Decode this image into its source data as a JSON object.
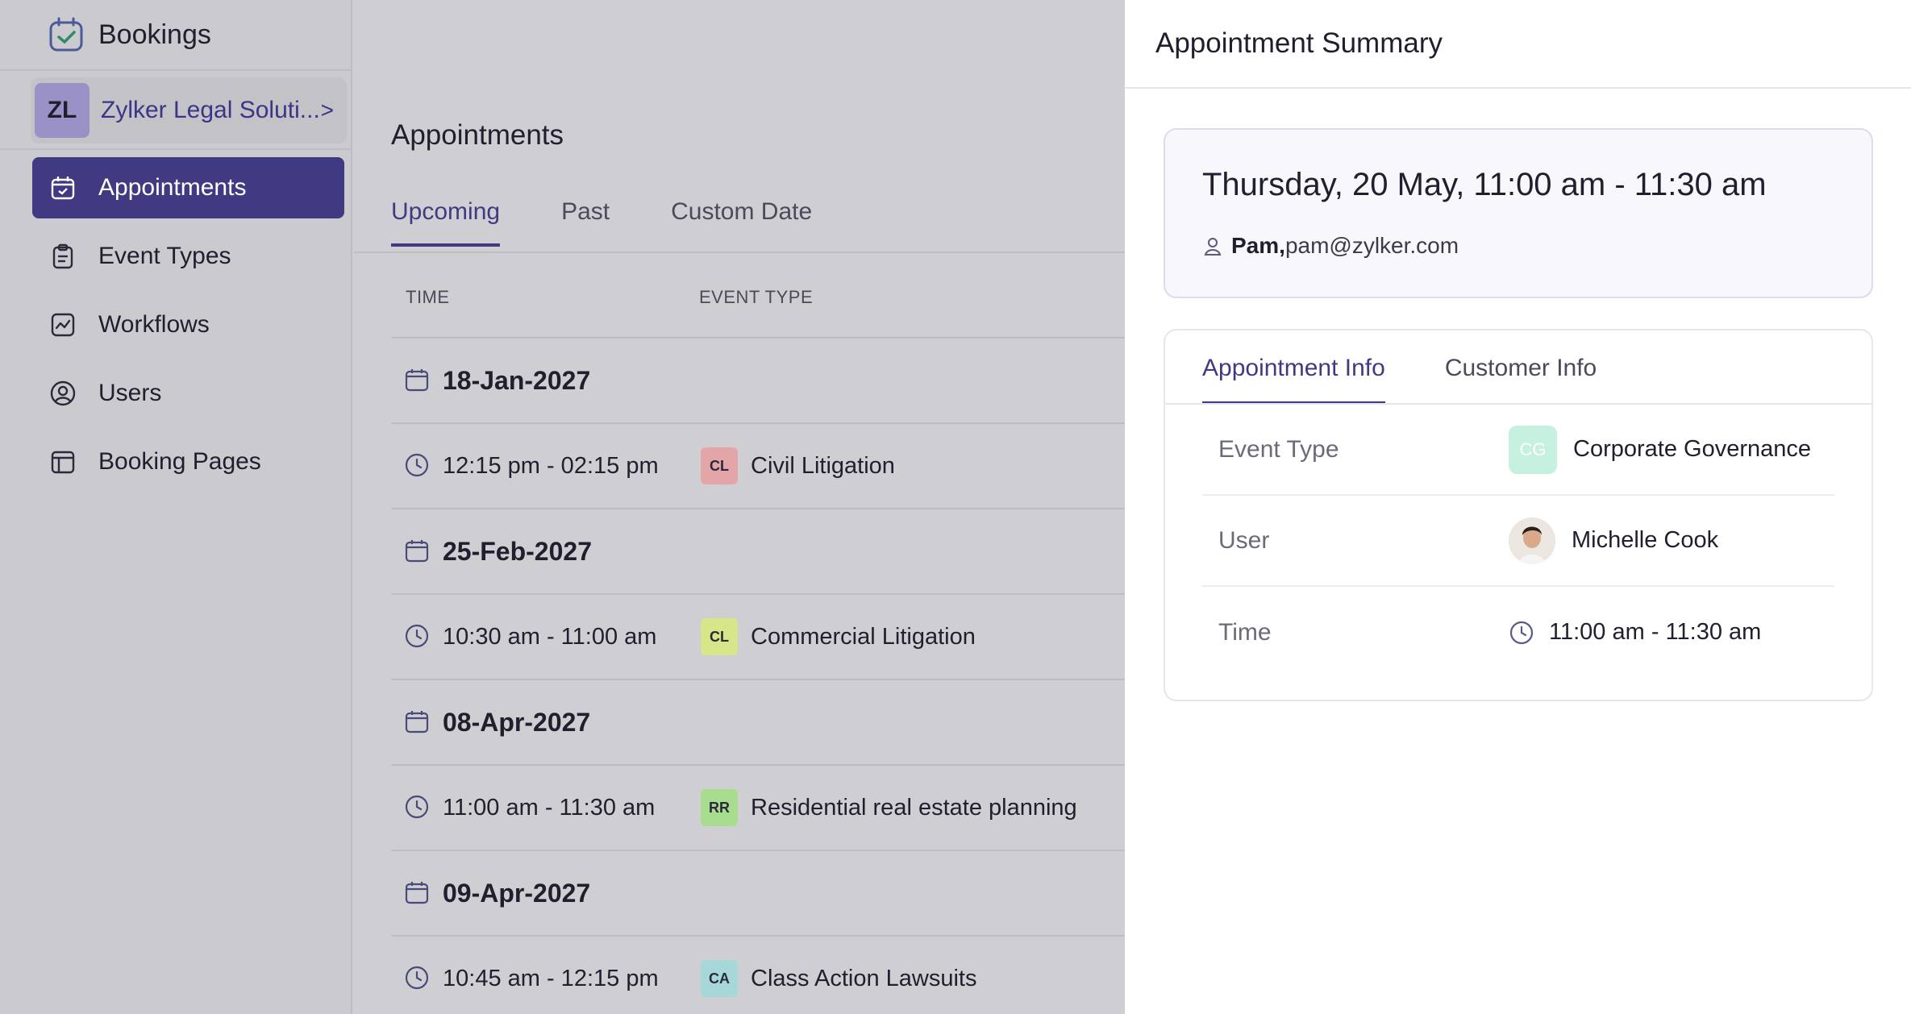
{
  "app": {
    "title": "Bookings"
  },
  "org": {
    "initials": "ZL",
    "name": "Zylker Legal Soluti...",
    "chevron": ">"
  },
  "nav": [
    {
      "label": "Appointments",
      "icon": "calendar-check-icon",
      "active": true
    },
    {
      "label": "Event Types",
      "icon": "clipboard-icon",
      "active": false
    },
    {
      "label": "Workflows",
      "icon": "workflow-icon",
      "active": false
    },
    {
      "label": "Users",
      "icon": "user-circle-icon",
      "active": false
    },
    {
      "label": "Booking Pages",
      "icon": "booking-page-icon",
      "active": false
    }
  ],
  "main": {
    "title": "Appointments",
    "tabs": [
      {
        "label": "Upcoming",
        "active": true
      },
      {
        "label": "Past",
        "active": false
      },
      {
        "label": "Custom Date",
        "active": false
      }
    ],
    "columns": {
      "time": "TIME",
      "event_type": "EVENT TYPE"
    },
    "groups": [
      {
        "date": "18-Jan-2027",
        "time": "12:15 pm - 02:15 pm",
        "badge": "CL",
        "badge_color": "#e4a5a8",
        "event": "Civil Litigation"
      },
      {
        "date": "25-Feb-2027",
        "time": "10:30 am - 11:00 am",
        "badge": "CL",
        "badge_color": "#d8e68a",
        "event": "Commercial Litigation"
      },
      {
        "date": "08-Apr-2027",
        "time": "11:00 am - 11:30 am",
        "badge": "RR",
        "badge_color": "#a8dc8e",
        "event": "Residential real estate planning"
      },
      {
        "date": "09-Apr-2027",
        "time": "10:45 am - 12:15 pm",
        "badge": "CA",
        "badge_color": "#a6d8da",
        "event": "Class Action Lawsuits"
      }
    ]
  },
  "panel": {
    "title": "Appointment Summary",
    "when": "Thursday, 20 May, 11:00 am - 11:30 am",
    "customer_name": "Pam,",
    "customer_email": "pam@zylker.com",
    "tabs": [
      {
        "label": "Appointment Info",
        "active": true
      },
      {
        "label": "Customer Info",
        "active": false
      }
    ],
    "info": {
      "event_type_label": "Event Type",
      "event_type_badge": "CG",
      "event_type_value": "Corporate Governance",
      "user_label": "User",
      "user_value": "Michelle Cook",
      "time_label": "Time",
      "time_value": "11:00 am - 11:30 am"
    }
  },
  "colors": {
    "accent": "#3f3a82",
    "overlay": "#cfcfd3",
    "panel_bg": "#ffffff"
  }
}
